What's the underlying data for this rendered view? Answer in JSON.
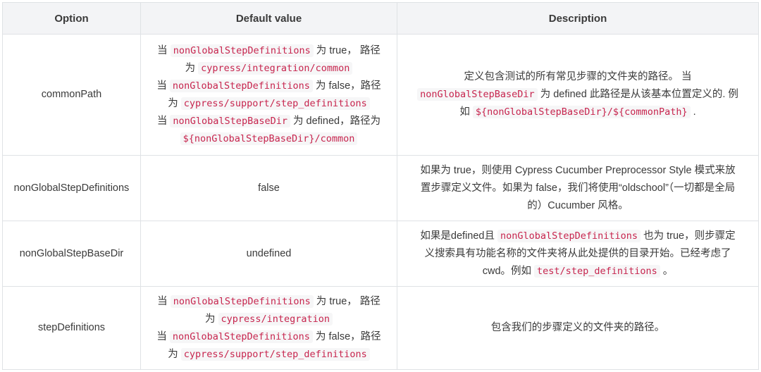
{
  "headers": {
    "option": "Option",
    "default_value": "Default value",
    "description": "Description"
  },
  "rows": [
    {
      "option": "commonPath",
      "default_value": {
        "l1": {
          "a": "当 ",
          "code": "nonGlobalStepDefinitions",
          "b": " 为 true， 路径"
        },
        "l2": {
          "a": "为 ",
          "code": "cypress/integration/common"
        },
        "l3": {
          "a": "当 ",
          "code": "nonGlobalStepDefinitions",
          "b": " 为 false，路径"
        },
        "l4": {
          "a": "为 ",
          "code": "cypress/support/step_definitions"
        },
        "l5": {
          "a": "当 ",
          "code": "nonGlobalStepBaseDir",
          "b": " 为 defined，路径为"
        },
        "l6": {
          "code": "${nonGlobalStepBaseDir}/common"
        }
      },
      "description": {
        "l1": "定义包含测试的所有常见步骤的文件夹的路径。 当",
        "l2": {
          "code": "nonGlobalStepBaseDir",
          "b": " 为 defined 此路径是从该基本位置定义的. 例"
        },
        "l3": {
          "a": "如 ",
          "code": "${nonGlobalStepBaseDir}/${commonPath}",
          "b": " ."
        }
      }
    },
    {
      "option": "nonGlobalStepDefinitions",
      "default_value": "false",
      "description": {
        "l1": "如果为 true，则使用 Cypress Cucumber Preprocessor Style 模式来放",
        "l2": "置步骤定义文件。如果为 false，我们将使用“oldschool”（一切都是全局",
        "l3": "的）Cucumber 风格。"
      }
    },
    {
      "option": "nonGlobalStepBaseDir",
      "default_value": "undefined",
      "description": {
        "l1": {
          "a": "如果是defined且 ",
          "code": "nonGlobalStepDefinitions",
          "b": " 也为 true，则步骤定"
        },
        "l2": "义搜索具有功能名称的文件夹将从此处提供的目录开始。已经考虑了",
        "l3": {
          "a": "cwd。例如 ",
          "code": "test/step_definitions",
          "b": " 。"
        }
      }
    },
    {
      "option": "stepDefinitions",
      "default_value": {
        "l1": {
          "a": "当 ",
          "code": "nonGlobalStepDefinitions",
          "b": " 为 true， 路径"
        },
        "l2": {
          "a": "为 ",
          "code": "cypress/integration"
        },
        "l3": {
          "a": "当 ",
          "code": "nonGlobalStepDefinitions",
          "b": " 为 false，路径"
        },
        "l4": {
          "a": "为 ",
          "code": "cypress/support/step_definitions"
        }
      },
      "description": "包含我们的步骤定义的文件夹的路径。"
    }
  ]
}
